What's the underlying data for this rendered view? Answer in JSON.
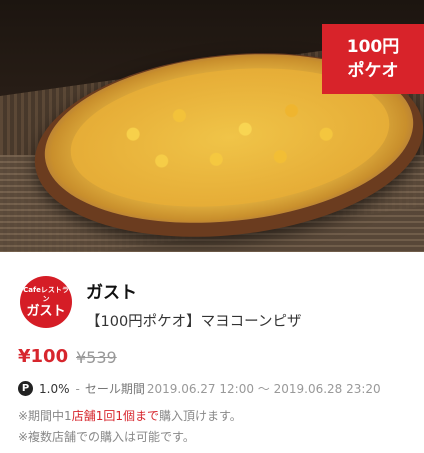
{
  "hero": {
    "badge_line1": "100円",
    "badge_line2": "ポケオ"
  },
  "shop": {
    "logo_small": "Cafeレストラン",
    "logo_big": "ガスト",
    "name": "ガスト"
  },
  "item": {
    "title": "【100円ポケオ】マヨコーンピザ"
  },
  "price": {
    "current": "¥100",
    "original": "¥539"
  },
  "meta": {
    "point_icon": "P",
    "rate": "1.0%",
    "period_label": "セール期間",
    "period": "2019.06.27 12:00 ～ 2019.06.28 23:20"
  },
  "notes": {
    "line1_a": "※期間中1",
    "line1_b": "店舗",
    "line1_c": "1回",
    "line1_d": "1個まで",
    "line1_e": "購入頂けます。",
    "line2": "※複数店舗での購入は可能です。"
  },
  "colors": {
    "accent": "#d7262d",
    "badge": "#d8232a"
  }
}
